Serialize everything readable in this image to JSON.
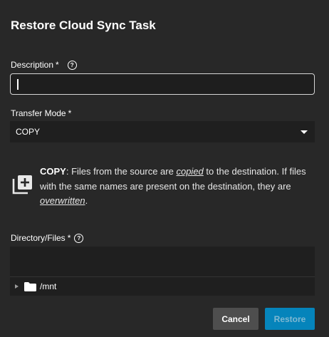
{
  "dialog": {
    "title": "Restore Cloud Sync Task"
  },
  "description": {
    "label": "Description",
    "required_mark": "*",
    "value": "",
    "help_icon": "help-circle-icon"
  },
  "transfer_mode": {
    "label": "Transfer Mode",
    "required_mark": "*",
    "selected": "COPY"
  },
  "mode_info": {
    "icon": "library-add-icon",
    "mode_name": "COPY",
    "text_1": ": Files from the source are ",
    "emphasis_1": "copied",
    "text_2": " to the destination. If files with the same names are present on the destination, they are ",
    "emphasis_2": "overwritten",
    "text_3": "."
  },
  "directory": {
    "label": "Directory/Files",
    "required_mark": "*",
    "help_icon": "help-circle-icon",
    "tree": [
      {
        "name": "/mnt",
        "icon": "folder-icon",
        "expand_icon": "caret-right-icon"
      }
    ]
  },
  "actions": {
    "cancel": "Cancel",
    "restore": "Restore"
  },
  "colors": {
    "background": "#282828",
    "field_background": "#1f1f1f",
    "primary": "#0095d5",
    "secondary_button": "#4e4e4e"
  }
}
